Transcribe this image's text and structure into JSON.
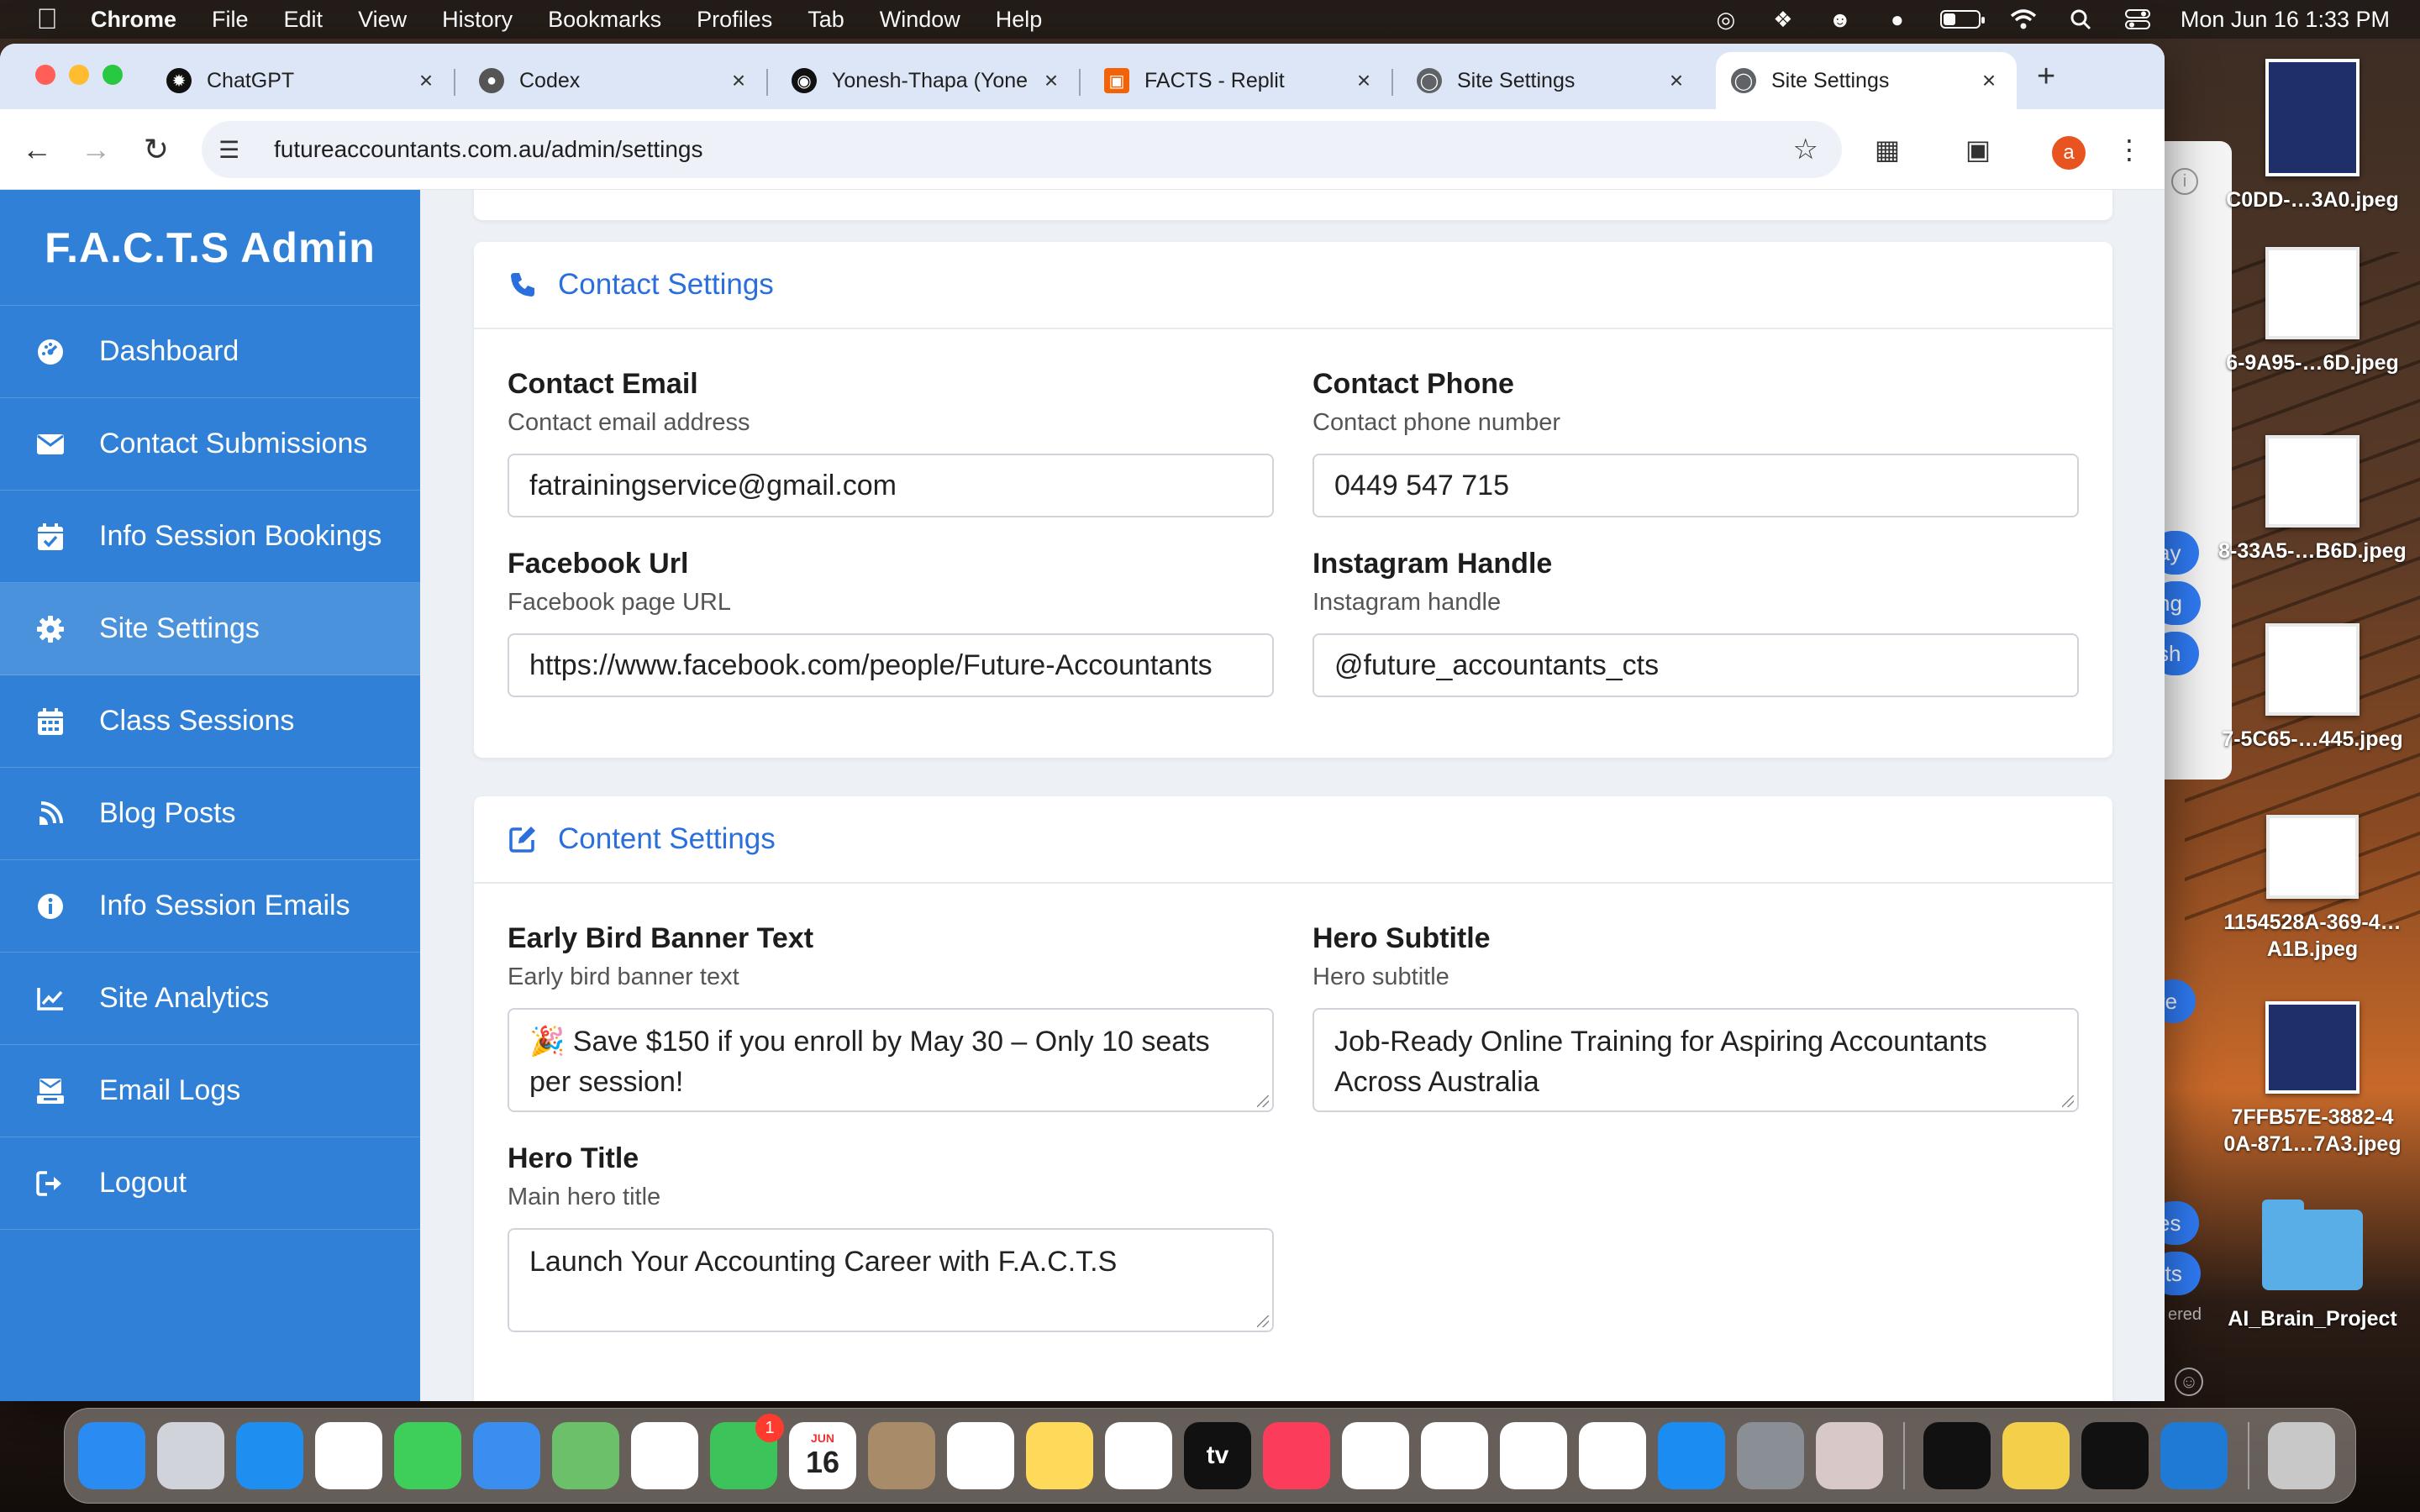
{
  "menubar": {
    "app_name": "Chrome",
    "items": [
      "File",
      "Edit",
      "View",
      "History",
      "Bookmarks",
      "Profiles",
      "Tab",
      "Window",
      "Help"
    ],
    "clock": "Mon Jun 16  1:33 PM",
    "battery_level": 0.35
  },
  "browser": {
    "tabs": [
      {
        "label": "ChatGPT",
        "favicon": "openai-icon",
        "color": "#111111",
        "active": false
      },
      {
        "label": "Codex",
        "favicon": "codex-icon",
        "color": "#555555",
        "active": false
      },
      {
        "label": "Yonesh-Thapa (Yone",
        "favicon": "github-icon",
        "color": "#111111",
        "active": false
      },
      {
        "label": "FACTS - Replit",
        "favicon": "replit-icon",
        "color": "#f26207",
        "active": false
      },
      {
        "label": "Site Settings",
        "favicon": "globe-icon",
        "color": "#5f6368",
        "active": false
      },
      {
        "label": "Site Settings",
        "favicon": "globe-icon",
        "color": "#5f6368",
        "active": true
      }
    ],
    "url": "futureaccountants.com.au/admin/settings",
    "profile_initial": "a"
  },
  "sidebar": {
    "brand": "F.A.C.T.S Admin",
    "items": [
      {
        "label": "Dashboard",
        "icon": "dashboard-icon",
        "active": false
      },
      {
        "label": "Contact Submissions",
        "icon": "envelope-icon",
        "active": false
      },
      {
        "label": "Info Session Bookings",
        "icon": "calendar-check-icon",
        "active": false
      },
      {
        "label": "Site Settings",
        "icon": "gear-icon",
        "active": true
      },
      {
        "label": "Class Sessions",
        "icon": "calendar-icon",
        "active": false
      },
      {
        "label": "Blog Posts",
        "icon": "blog-icon",
        "active": false
      },
      {
        "label": "Info Session Emails",
        "icon": "info-icon",
        "active": false
      },
      {
        "label": "Site Analytics",
        "icon": "chart-line-icon",
        "active": false
      },
      {
        "label": "Email Logs",
        "icon": "mail-bulk-icon",
        "active": false
      },
      {
        "label": "Logout",
        "icon": "logout-icon",
        "active": false
      }
    ]
  },
  "contact_settings": {
    "title": "Contact Settings",
    "fields": [
      {
        "label": "Contact Email",
        "description": "Contact email address",
        "value": "fatrainingservice@gmail.com"
      },
      {
        "label": "Contact Phone",
        "description": "Contact phone number",
        "value": "0449 547 715"
      },
      {
        "label": "Facebook Url",
        "description": "Facebook page URL",
        "value": "https://www.facebook.com/people/Future-Accountants"
      },
      {
        "label": "Instagram Handle",
        "description": "Instagram handle",
        "value": "@future_accountants_cts"
      }
    ]
  },
  "content_settings": {
    "title": "Content Settings",
    "fields": [
      {
        "label": "Early Bird Banner Text",
        "description": "Early bird banner text",
        "value": "🎉 Save $150 if you enroll by May 30 – Only 10 seats per session!"
      },
      {
        "label": "Hero Subtitle",
        "description": "Hero subtitle",
        "value": "Job-Ready Online Training for Aspiring Accountants Across Australia"
      },
      {
        "label": "Hero Title",
        "description": "Main hero title",
        "value": "Launch Your Accounting Career with F.A.C.T.S"
      }
    ]
  },
  "desktop": {
    "files": [
      {
        "name": "C0DD-…3A0.jpeg"
      },
      {
        "name": "6-9A95-…6D.jpeg"
      },
      {
        "name": "8-33A5-…B6D.jpeg"
      },
      {
        "name": "7-5C65-…445.jpeg"
      },
      {
        "name": "1154528A-369-4…A1B.jpeg"
      },
      {
        "name": "7FFB57E-3882-4 0A-871…7A3.jpeg"
      },
      {
        "name": "AI_Brain_Project"
      }
    ],
    "bubbles": [
      "ay",
      "ng",
      "sh",
      "re",
      "es",
      "rts"
    ],
    "bubble_caption": "ered"
  },
  "dock": {
    "apps": [
      {
        "name": "finder",
        "color": "#2a8bf2"
      },
      {
        "name": "launchpad",
        "color": "#d0d4da"
      },
      {
        "name": "safari",
        "color": "#1f8ef1"
      },
      {
        "name": "chrome",
        "color": "#ffffff"
      },
      {
        "name": "messages",
        "color": "#3ecf5a"
      },
      {
        "name": "mail",
        "color": "#3a8ef0"
      },
      {
        "name": "maps",
        "color": "#6cc06a"
      },
      {
        "name": "photos",
        "color": "#ffffff"
      },
      {
        "name": "facetime",
        "color": "#3cc45a",
        "badge": "1"
      },
      {
        "name": "calendar",
        "color": "#ffffff",
        "label": "16",
        "sub": "JUN"
      },
      {
        "name": "contacts",
        "color": "#a88c6a"
      },
      {
        "name": "reminders",
        "color": "#ffffff"
      },
      {
        "name": "notes",
        "color": "#ffd95a"
      },
      {
        "name": "freeform",
        "color": "#ffffff"
      },
      {
        "name": "tv",
        "color": "#111111",
        "label": "tv"
      },
      {
        "name": "music",
        "color": "#fc3c5b"
      },
      {
        "name": "news",
        "color": "#ffffff"
      },
      {
        "name": "keynote",
        "color": "#ffffff"
      },
      {
        "name": "numbers",
        "color": "#ffffff"
      },
      {
        "name": "pages",
        "color": "#ffffff"
      },
      {
        "name": "app-store",
        "color": "#1a8cf2"
      },
      {
        "name": "system-settings",
        "color": "#8a8f96"
      },
      {
        "name": "iphone-mirroring",
        "color": "#d8c8c8"
      },
      {
        "name": "terminal",
        "color": "#111111"
      },
      {
        "name": "python",
        "color": "#f4d04a"
      },
      {
        "name": "clock",
        "color": "#111111"
      },
      {
        "name": "vscode",
        "color": "#1f7ad6"
      },
      {
        "name": "trash",
        "color": "#c8c8c8"
      }
    ]
  }
}
